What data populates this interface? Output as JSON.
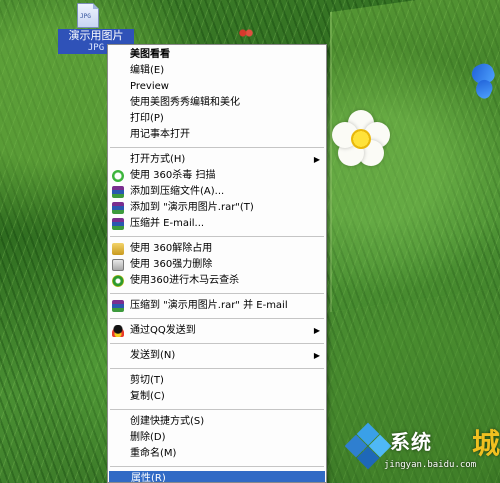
{
  "desktop": {
    "file": {
      "name": "演示用图片",
      "ext": "JPG",
      "badge": "JPG"
    }
  },
  "menu": {
    "items": [
      {
        "type": "item",
        "label": "美图看看",
        "bold": true
      },
      {
        "type": "item",
        "label": "编辑(E)"
      },
      {
        "type": "item",
        "label": "Preview"
      },
      {
        "type": "item",
        "label": "使用美图秀秀编辑和美化"
      },
      {
        "type": "item",
        "label": "打印(P)"
      },
      {
        "type": "item",
        "label": "用记事本打开"
      },
      {
        "type": "sep"
      },
      {
        "type": "item",
        "label": "打开方式(H)",
        "submenu": true
      },
      {
        "type": "item",
        "label": "使用 360杀毒 扫描",
        "icon": "360-antivirus-icon",
        "iconClass": "ico-360"
      },
      {
        "type": "item",
        "label": "添加到压缩文件(A)...",
        "icon": "winrar-icon",
        "iconClass": "ico-rar"
      },
      {
        "type": "item",
        "label": "添加到 \"演示用图片.rar\"(T)",
        "icon": "winrar-icon",
        "iconClass": "ico-rar"
      },
      {
        "type": "item",
        "label": "压缩并 E-mail...",
        "icon": "winrar-icon",
        "iconClass": "ico-rar"
      },
      {
        "type": "sep"
      },
      {
        "type": "item",
        "label": "使用 360解除占用",
        "icon": "unlock-icon",
        "iconClass": "ico-unlock"
      },
      {
        "type": "item",
        "label": "使用 360强力删除",
        "icon": "shred-icon",
        "iconClass": "ico-del"
      },
      {
        "type": "item",
        "label": "使用360进行木马云查杀",
        "icon": "trojan-scan-icon",
        "iconClass": "ico-trojan"
      },
      {
        "type": "sep"
      },
      {
        "type": "item",
        "label": "压缩到 \"演示用图片.rar\" 并 E-mail",
        "icon": "winrar-icon",
        "iconClass": "ico-rar"
      },
      {
        "type": "sep"
      },
      {
        "type": "item",
        "label": "通过QQ发送到",
        "icon": "qq-icon",
        "iconClass": "ico-qq",
        "submenu": true
      },
      {
        "type": "sep"
      },
      {
        "type": "item",
        "label": "发送到(N)",
        "submenu": true
      },
      {
        "type": "sep"
      },
      {
        "type": "item",
        "label": "剪切(T)"
      },
      {
        "type": "item",
        "label": "复制(C)"
      },
      {
        "type": "sep"
      },
      {
        "type": "item",
        "label": "创建快捷方式(S)"
      },
      {
        "type": "item",
        "label": "删除(D)"
      },
      {
        "type": "item",
        "label": "重命名(M)"
      },
      {
        "type": "sep"
      },
      {
        "type": "item",
        "label": "属性(R)",
        "selected": true
      }
    ]
  },
  "watermark": {
    "text": "系统",
    "cheng": "城",
    "url": "jingyan.baidu.com"
  },
  "colors": {
    "selection": "#316ac5",
    "menuBg": "#fdfdfd",
    "fileLabelBg": "#2f52b8"
  }
}
